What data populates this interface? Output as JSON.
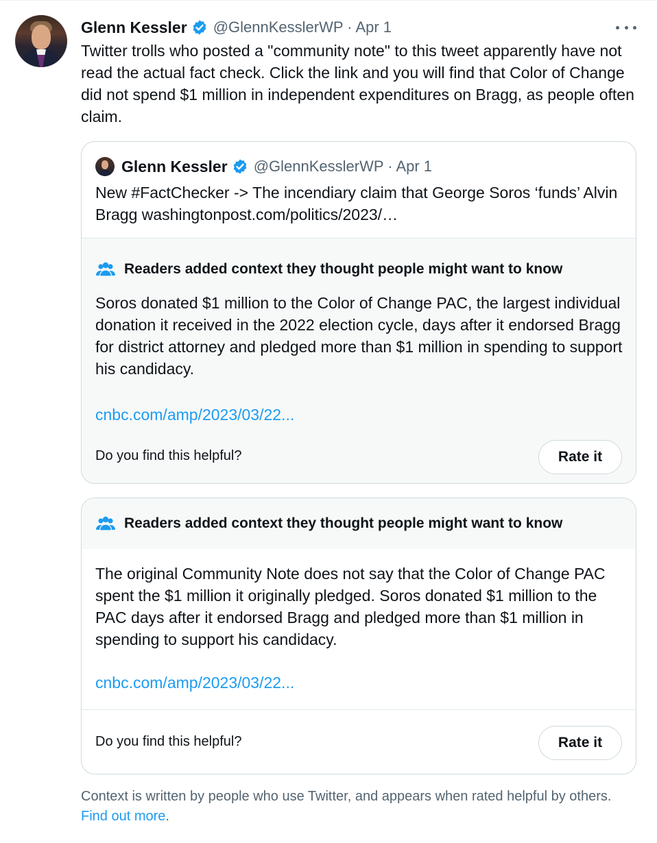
{
  "tweet": {
    "author_name": "Glenn Kessler",
    "handle_date": "@GlennKesslerWP · Apr 1",
    "text": "Twitter trolls who posted a \"community note\" to this tweet apparently have not read the actual fact check. Click the link and you will find that Color of Change did not spend $1 million in independent expenditures on Bragg, as people often claim."
  },
  "quoted_tweet": {
    "author_name": "Glenn Kessler",
    "handle_date": "@GlennKesslerWP · Apr 1",
    "text": "New #FactChecker -> The incendiary claim that George Soros ‘funds’ Alvin Bragg washingtonpost.com/politics/2023/…",
    "note": {
      "title": "Readers added context they thought people might want to know",
      "text": "Soros donated $1 million to the Color of Change PAC, the largest individual donation it received in the 2022 election cycle, days after it endorsed Bragg for district attorney and pledged more than $1 million in spending to support his candidacy.",
      "link": "cnbc.com/amp/2023/03/22...",
      "helpful_prompt": "Do you find this helpful?",
      "rate_label": "Rate it"
    }
  },
  "note2": {
    "title": "Readers added context they thought people might want to know",
    "text": "The original Community Note does not say that the Color of Change PAC spent the $1 million it originally pledged. Soros donated $1 million to the PAC days after it endorsed Bragg and pledged more than $1 million in spending to support his candidacy.",
    "link": "cnbc.com/amp/2023/03/22...",
    "helpful_prompt": "Do you find this helpful?",
    "rate_label": "Rate it"
  },
  "footer": {
    "text": "Context is written by people who use Twitter, and appears when rated helpful by others. ",
    "link": "Find out more",
    "end": "."
  },
  "colors": {
    "accent": "#1d9bf0",
    "secondary_text": "#536471",
    "note_background": "#f7f9f9"
  },
  "icons": [
    "verified-badge-icon",
    "more-options-icon",
    "people-icon"
  ]
}
